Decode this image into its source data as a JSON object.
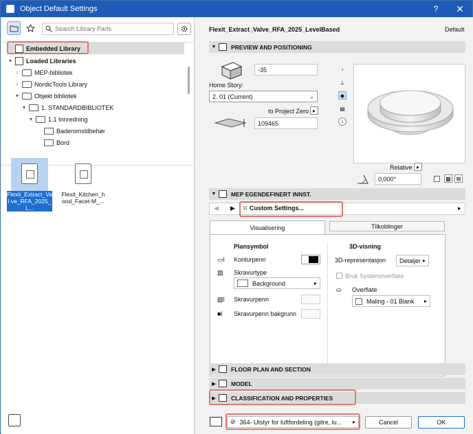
{
  "window": {
    "title": "Object Default Settings",
    "help": "?",
    "close": "✕"
  },
  "left": {
    "search_placeholder": "Search Library Parts",
    "tree": [
      {
        "label": "Embedded Library",
        "level": 0,
        "arrow": "",
        "kind": "book"
      },
      {
        "label": "Loaded Libraries",
        "level": 0,
        "arrow": "▾",
        "kind": "book"
      },
      {
        "label": "MEP-bibliotek",
        "level": 1,
        "arrow": "›",
        "kind": "folder"
      },
      {
        "label": "NordicTools Library",
        "level": 1,
        "arrow": "›",
        "kind": "folder"
      },
      {
        "label": "Objekt bibliotek",
        "level": 1,
        "arrow": "▾",
        "kind": "folder"
      },
      {
        "label": "1. STANDARDBIBLIOTEK",
        "level": 2,
        "arrow": "▾",
        "kind": "folder"
      },
      {
        "label": "1.1 Innredning",
        "level": 3,
        "arrow": "▾",
        "kind": "folder"
      },
      {
        "label": "Baderomstilbehør",
        "level": 4,
        "arrow": "",
        "kind": "folder"
      },
      {
        "label": "Bord",
        "level": 4,
        "arrow": "",
        "kind": "folder"
      }
    ],
    "files": [
      {
        "name": "Flexit_Extract_Valve_RFA_2025_L...",
        "name_display": "Flexit_Extract_Val ve_RFA_2025_L...",
        "selected": true
      },
      {
        "name": "Flexit_Kitchen_hood_Facet-M_...",
        "name_display": "Flexit_Kitchen_h ood_Facet-M_...",
        "selected": false
      }
    ]
  },
  "right": {
    "object_name": "Flexit_Extract_Valve_RFA_2025_LevelBased",
    "default_label": "Default",
    "preview_section": "PREVIEW AND POSITIONING",
    "elevation_value": "-35",
    "home_story_label": "Home Story:",
    "home_story_value": "2. 01 (Current)",
    "to_project_zero": "to Project Zero",
    "project_zero_value": "109465",
    "relative_label": "Relative",
    "angle_value": "0,000°",
    "mep_section": "MEP EGENDEFINERT INNST.",
    "custom_settings": "Custom Settings...",
    "tabs": [
      "Visualisering",
      "Tilkoblinger"
    ],
    "plansymbol": "Plansymbol",
    "konturpenn": "Konturpenn",
    "skravurtype": "Skravurtype",
    "background": "Background",
    "skravurpenn": "Skravurpenn",
    "skravurpenn_bg": "Skravurpenn bakgrunn",
    "visning3d": "3D-visning",
    "representasjon_label": "3D-representasjon",
    "representasjon_value": "Detaljer",
    "bruk_system": "Bruk Systemoverflate",
    "overflate": "Overflate",
    "overflate_value": "Maling - 01 Blank",
    "floor_plan": "FLOOR PLAN AND SECTION",
    "model": "MODEL",
    "classification": "CLASSIFICATION AND PROPERTIES",
    "layer_value": "364- Utstyr for luftfordeling (gitre, lu...",
    "cancel": "Cancel",
    "ok": "OK"
  },
  "colors": {
    "title_bar": "#1e5bb8",
    "highlight": "#e07a6e",
    "selection": "#1e6fd0"
  }
}
